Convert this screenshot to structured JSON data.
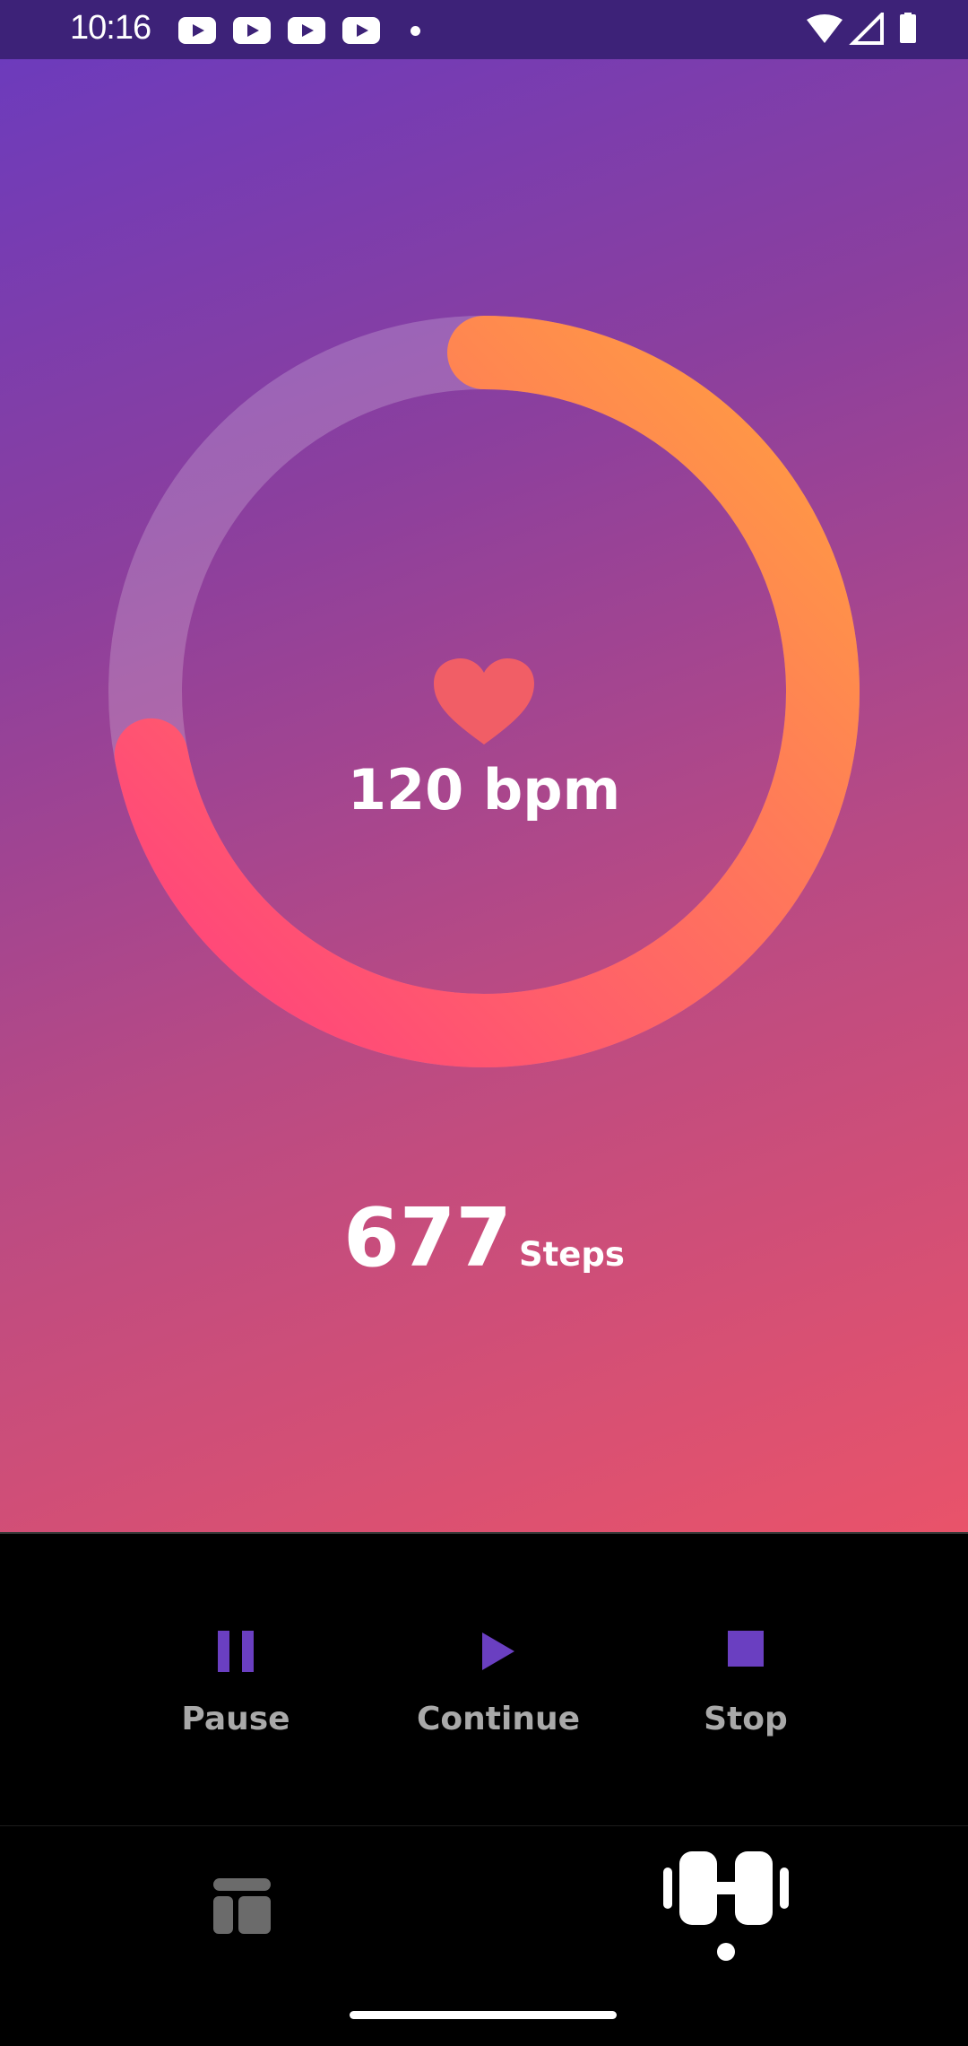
{
  "status_bar": {
    "time": "10:16",
    "notification_icons": [
      "youtube-icon",
      "youtube-icon",
      "youtube-icon",
      "youtube-icon"
    ],
    "right_icons": [
      "wifi-icon",
      "signal-icon",
      "battery-icon"
    ]
  },
  "workout": {
    "heart_rate_value": "120 bpm",
    "heart_icon": "heart-icon",
    "ring_progress_fraction": 0.72,
    "steps_value": "677",
    "steps_label": "Steps"
  },
  "controls": {
    "pause_label": "Pause",
    "continue_label": "Continue",
    "stop_label": "Stop"
  },
  "bottom_nav": {
    "items": [
      "dashboard-icon",
      "workout-icon"
    ],
    "active_index": 1
  },
  "colors": {
    "accent": "#6a3fc1",
    "ring_start": "#ff3f7f",
    "ring_end": "#ffa83f",
    "ring_track": "#ffffff33"
  }
}
